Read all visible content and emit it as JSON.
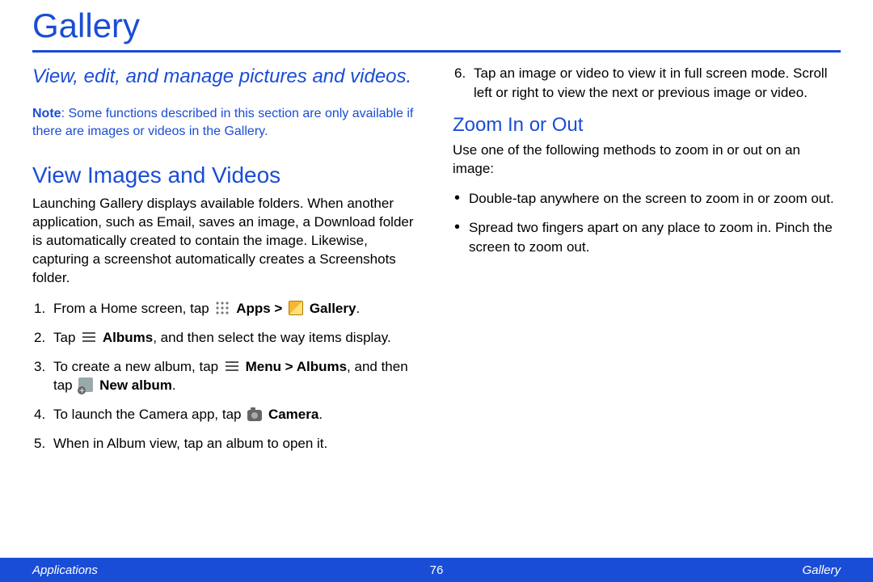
{
  "title": "Gallery",
  "subtitle": "View, edit, and manage pictures and videos.",
  "note_label": "Note",
  "note_text": ": Some functions described in this section are only available if there are images or videos in the Gallery.",
  "section1_heading": "View Images and Videos",
  "section1_body": "Launching Gallery displays available folders. When another application, such as Email, saves an image, a Download folder is automatically created to contain the image. Likewise, capturing a screenshot automatically creates a Screenshots folder.",
  "steps": {
    "s1_a": "From a Home screen, tap ",
    "s1_apps": "Apps > ",
    "s1_gallery": "Gallery",
    "s1_end": ".",
    "s2_a": "Tap ",
    "s2_albums": "Albums",
    "s2_b": ", and then select the way items display.",
    "s3_a": "To create a new album, tap ",
    "s3_menu": "Menu > Albums",
    "s3_b": ", and then tap ",
    "s3_new": "New album",
    "s3_end": ".",
    "s4_a": "To launch the Camera app, tap ",
    "s4_cam": "Camera",
    "s4_end": ".",
    "s5": "When in Album view, tap an album to open it.",
    "s6": "Tap an image or video to view it in full screen mode. Scroll left or right to view the next or previous image or video."
  },
  "section2_heading": "Zoom In or Out",
  "section2_body": "Use one of the following methods to zoom in or out on an image:",
  "bullets": {
    "b1": "Double-tap anywhere on the screen to zoom in or zoom out.",
    "b2": "Spread two fingers apart on any place to zoom in. Pinch the screen to zoom out."
  },
  "footer": {
    "left": "Applications",
    "center": "76",
    "right": "Gallery"
  }
}
